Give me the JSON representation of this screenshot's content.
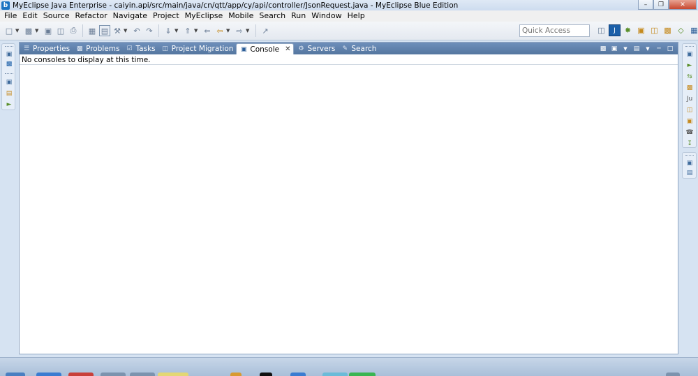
{
  "window": {
    "title": "MyEclipse Java Enterprise - caiyin.api/src/main/java/cn/qtt/app/cy/api/controller/JsonRequest.java - MyEclipse Blue Edition",
    "app_icon_letter": "b"
  },
  "menu": [
    "File",
    "Edit",
    "Source",
    "Refactor",
    "Navigate",
    "Project",
    "MyEclipse",
    "Mobile",
    "Search",
    "Run",
    "Window",
    "Help"
  ],
  "toolbar": {
    "quick_access_placeholder": "Quick Access"
  },
  "tabs": [
    {
      "label": "Properties",
      "icon": "properties-icon"
    },
    {
      "label": "Problems",
      "icon": "problems-icon"
    },
    {
      "label": "Tasks",
      "icon": "tasks-icon"
    },
    {
      "label": "Project Migration",
      "icon": "project-migration-icon"
    },
    {
      "label": "Console",
      "icon": "console-icon",
      "active": true
    },
    {
      "label": "Servers",
      "icon": "servers-icon"
    },
    {
      "label": "Search",
      "icon": "search-icon"
    }
  ],
  "console": {
    "message": "No consoles to display at this time."
  },
  "colors": {
    "tabbar": "#5f81ad",
    "accent": "#1b5fa8"
  }
}
